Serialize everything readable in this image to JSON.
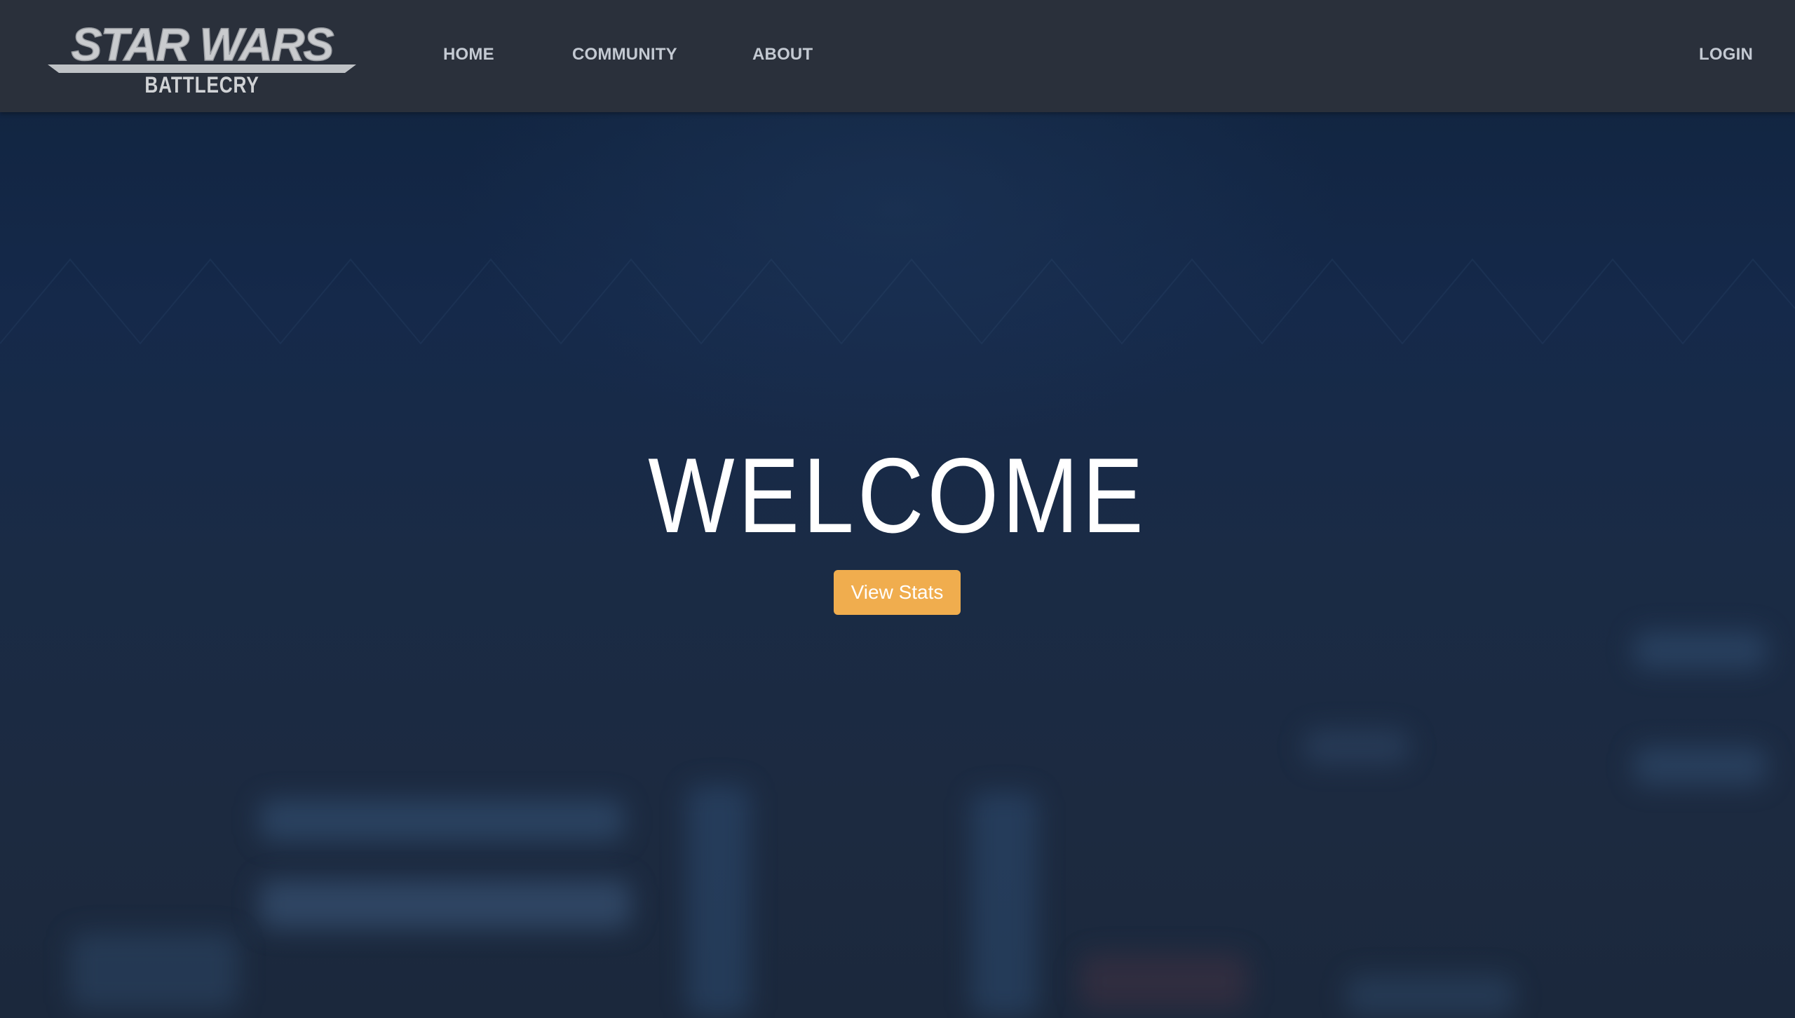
{
  "brand": {
    "logo_line1": "STAR WARS",
    "logo_line2": "BATTLECRY"
  },
  "nav": {
    "links": [
      {
        "label": "HOME"
      },
      {
        "label": "COMMUNITY"
      },
      {
        "label": "ABOUT"
      }
    ],
    "login_label": "LOGIN"
  },
  "hero": {
    "heading": "WELCOME",
    "cta_label": "View Stats"
  },
  "colors": {
    "navbar_bg": "#2a303b",
    "nav_text": "#c3c9d2",
    "hero_bg": "#14243a",
    "cta_bg": "#f0ad4e",
    "heading_text": "#ffffff"
  }
}
